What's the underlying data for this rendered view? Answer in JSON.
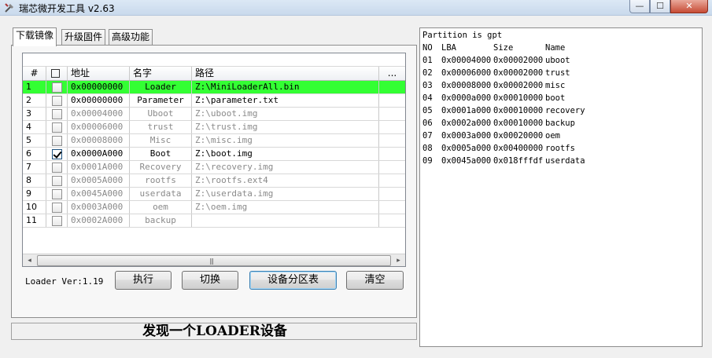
{
  "window": {
    "title": "瑞芯微开发工具 v2.63",
    "minimize_label": "—",
    "maximize_label": "☐",
    "close_label": "✕"
  },
  "tabs": [
    {
      "label": "下载镜像"
    },
    {
      "label": "升级固件"
    },
    {
      "label": "高级功能"
    }
  ],
  "grid": {
    "headers": {
      "no": "#",
      "address": "地址",
      "name": "名字",
      "path": "路径",
      "more": "..."
    },
    "rows": [
      {
        "no": "1",
        "checked": false,
        "address": "0x00000000",
        "name": "Loader",
        "path": "Z:\\MiniLoaderAll.bin"
      },
      {
        "no": "2",
        "checked": false,
        "address": "0x00000000",
        "name": "Parameter",
        "path": "Z:\\parameter.txt"
      },
      {
        "no": "3",
        "checked": false,
        "address": "0x00004000",
        "name": "Uboot",
        "path": "Z:\\uboot.img"
      },
      {
        "no": "4",
        "checked": false,
        "address": "0x00006000",
        "name": "trust",
        "path": "Z:\\trust.img"
      },
      {
        "no": "5",
        "checked": false,
        "address": "0x00008000",
        "name": "Misc",
        "path": "Z:\\misc.img"
      },
      {
        "no": "6",
        "checked": true,
        "address": "0x0000A000",
        "name": "Boot",
        "path": "Z:\\boot.img"
      },
      {
        "no": "7",
        "checked": false,
        "address": "0x0001A000",
        "name": "Recovery",
        "path": "Z:\\recovery.img"
      },
      {
        "no": "8",
        "checked": false,
        "address": "0x0005A000",
        "name": "rootfs",
        "path": "Z:\\rootfs.ext4"
      },
      {
        "no": "9",
        "checked": false,
        "address": "0x0045A000",
        "name": "userdata",
        "path": "Z:\\userdata.img"
      },
      {
        "no": "10",
        "checked": false,
        "address": "0x0003A000",
        "name": "oem",
        "path": "Z:\\oem.img"
      },
      {
        "no": "11",
        "checked": false,
        "address": "0x0002A000",
        "name": "backup",
        "path": ""
      }
    ],
    "scroll_left": "◂",
    "scroll_right": "▸",
    "scroll_grip": "|||"
  },
  "footer": {
    "loader_version": "Loader Ver:1.19",
    "run_button": "执行",
    "switch_button": "切换",
    "partition_button": "设备分区表",
    "clear_button": "清空"
  },
  "status": {
    "message": "发现一个LOADER设备"
  },
  "log": {
    "title": "Partition is gpt",
    "header": {
      "no": "NO",
      "lba": "LBA",
      "size": "Size",
      "name": "Name"
    },
    "entries": [
      {
        "no": "01",
        "lba": "0x00004000",
        "size": "0x00002000",
        "name": "uboot"
      },
      {
        "no": "02",
        "lba": "0x00006000",
        "size": "0x00002000",
        "name": "trust"
      },
      {
        "no": "03",
        "lba": "0x00008000",
        "size": "0x00002000",
        "name": "misc"
      },
      {
        "no": "04",
        "lba": "0x0000a000",
        "size": "0x00010000",
        "name": "boot"
      },
      {
        "no": "05",
        "lba": "0x0001a000",
        "size": "0x00010000",
        "name": "recovery"
      },
      {
        "no": "06",
        "lba": "0x0002a000",
        "size": "0x00010000",
        "name": "backup"
      },
      {
        "no": "07",
        "lba": "0x0003a000",
        "size": "0x00020000",
        "name": "oem"
      },
      {
        "no": "08",
        "lba": "0x0005a000",
        "size": "0x00400000",
        "name": "rootfs"
      },
      {
        "no": "09",
        "lba": "0x0045a000",
        "size": "0x018fffdf",
        "name": "userdata"
      }
    ]
  }
}
